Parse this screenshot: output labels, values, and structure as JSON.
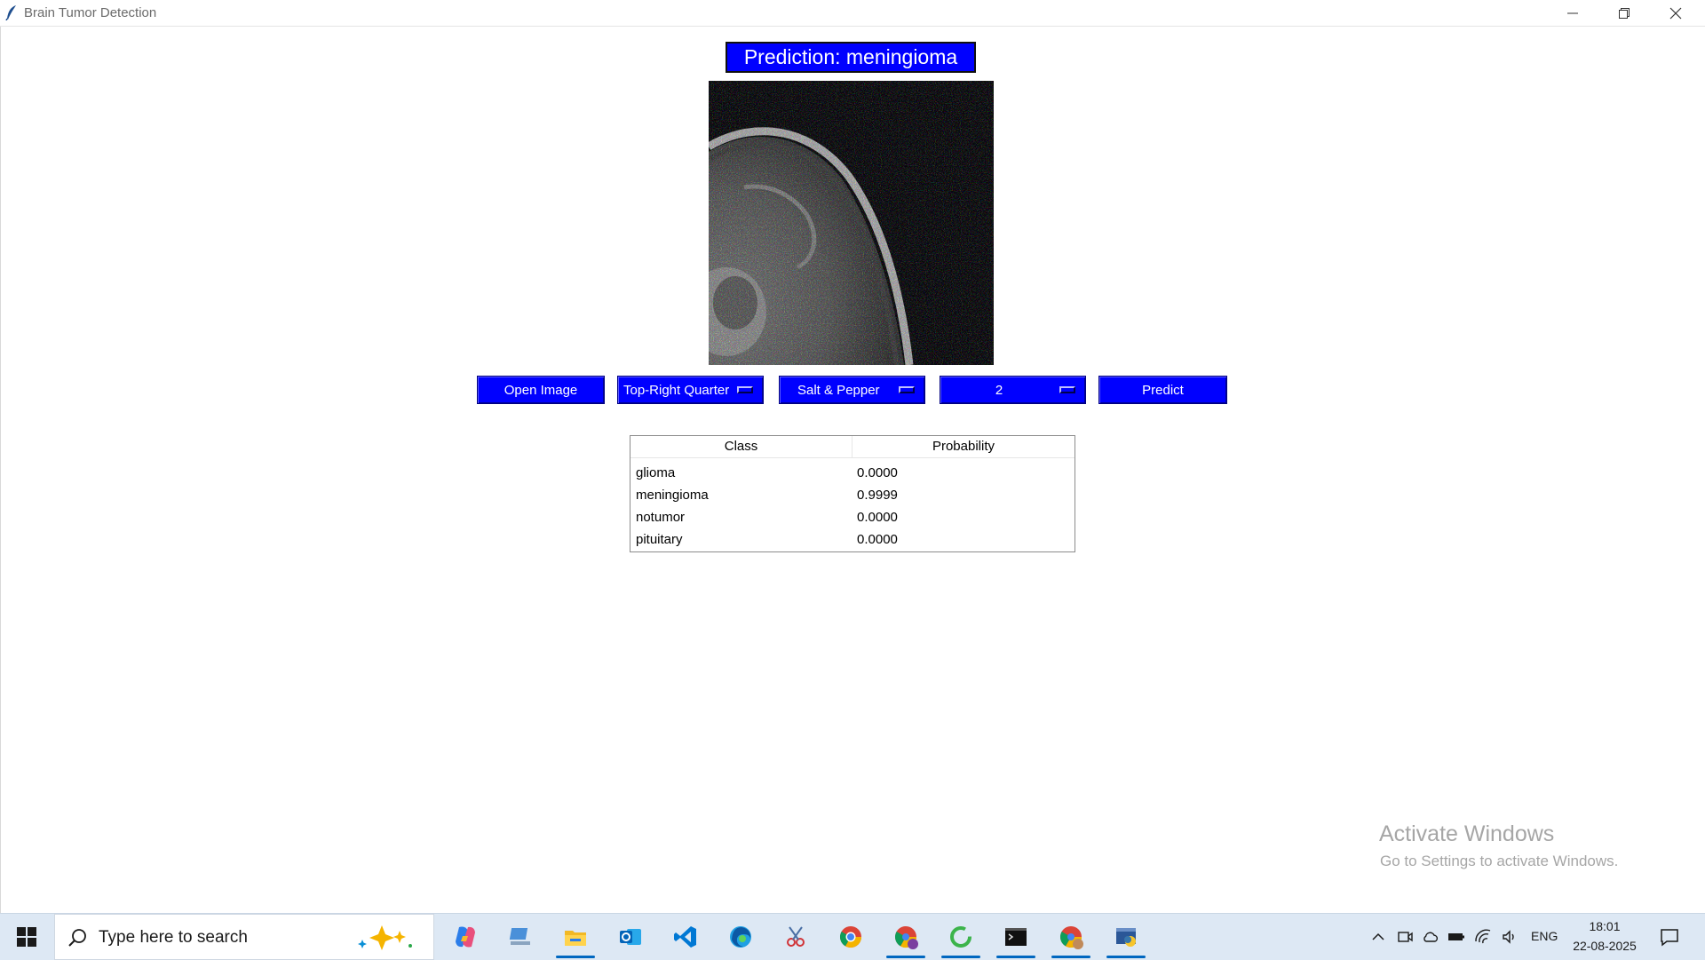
{
  "window": {
    "title": "Brain Tumor Detection"
  },
  "prediction": {
    "label": "Prediction: meningioma"
  },
  "controls": {
    "open_image_label": "Open Image",
    "region_selected": "Top-Right Quarter",
    "noise_selected": "Salt & Pepper",
    "level_selected": "2",
    "predict_label": "Predict"
  },
  "table": {
    "headers": [
      "Class",
      "Probability"
    ],
    "rows": [
      {
        "class": "glioma",
        "probability": "0.0000"
      },
      {
        "class": "meningioma",
        "probability": "0.9999"
      },
      {
        "class": "notumor",
        "probability": "0.0000"
      },
      {
        "class": "pituitary",
        "probability": "0.0000"
      }
    ]
  },
  "watermark": {
    "title": "Activate Windows",
    "subtitle": "Go to Settings to activate Windows."
  },
  "taskbar": {
    "search_placeholder": "Type here to search",
    "apps": [
      "copilot-icon",
      "file-icon",
      "file-explorer-icon",
      "outlook-icon",
      "vscode-icon",
      "edge-icon",
      "snipping-tool-icon",
      "chrome-icon",
      "chrome-profile-icon",
      "refresh-app-icon",
      "terminal-icon",
      "chrome-user-icon",
      "python-app-icon"
    ],
    "language": "ENG",
    "time": "18:01",
    "date": "22-08-2025"
  },
  "colors": {
    "accent_blue": "#0000ff",
    "taskbar_bg": "#dde8f4",
    "watermark_text": "#a6a6a6"
  }
}
